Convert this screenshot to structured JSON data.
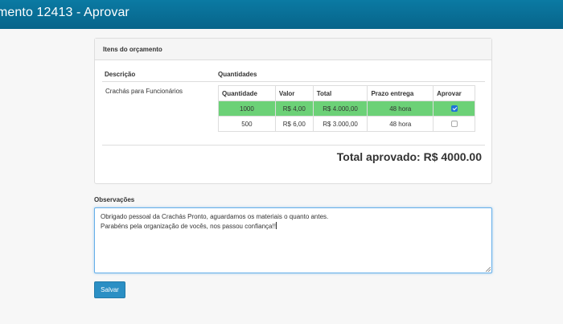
{
  "header": {
    "title": "mento 12413 - Aprovar"
  },
  "panel": {
    "heading": "Itens do orçamento",
    "col_descricao": "Descrição",
    "col_quantidades": "Quantidades",
    "item_description": "Crachás para Funcionários",
    "table": {
      "headers": [
        "Quantidade",
        "Valor",
        "Total",
        "Prazo entrega",
        "Aprovar"
      ],
      "rows": [
        {
          "quantidade": "1000",
          "valor": "R$ 4,00",
          "total": "R$ 4.000,00",
          "prazo": "48 hora",
          "approved": true
        },
        {
          "quantidade": "500",
          "valor": "R$ 6,00",
          "total": "R$ 3.000,00",
          "prazo": "48 hora",
          "approved": false
        }
      ]
    },
    "total_text": "Total aprovado: R$ 4000.00"
  },
  "observacoes": {
    "label": "Observações",
    "line1": "Obrigado pessoal da Crachás Pronto, aguardamos os materiais o quanto antes.",
    "line2": "Parabéns pela organização de vocês, nos passou confiança!!"
  },
  "save_button": {
    "label": "Salvar"
  },
  "colors": {
    "header": "#07648a",
    "approved_row": "#6cd177",
    "button": "#2b8fc4",
    "focus_border": "#66afe9"
  }
}
